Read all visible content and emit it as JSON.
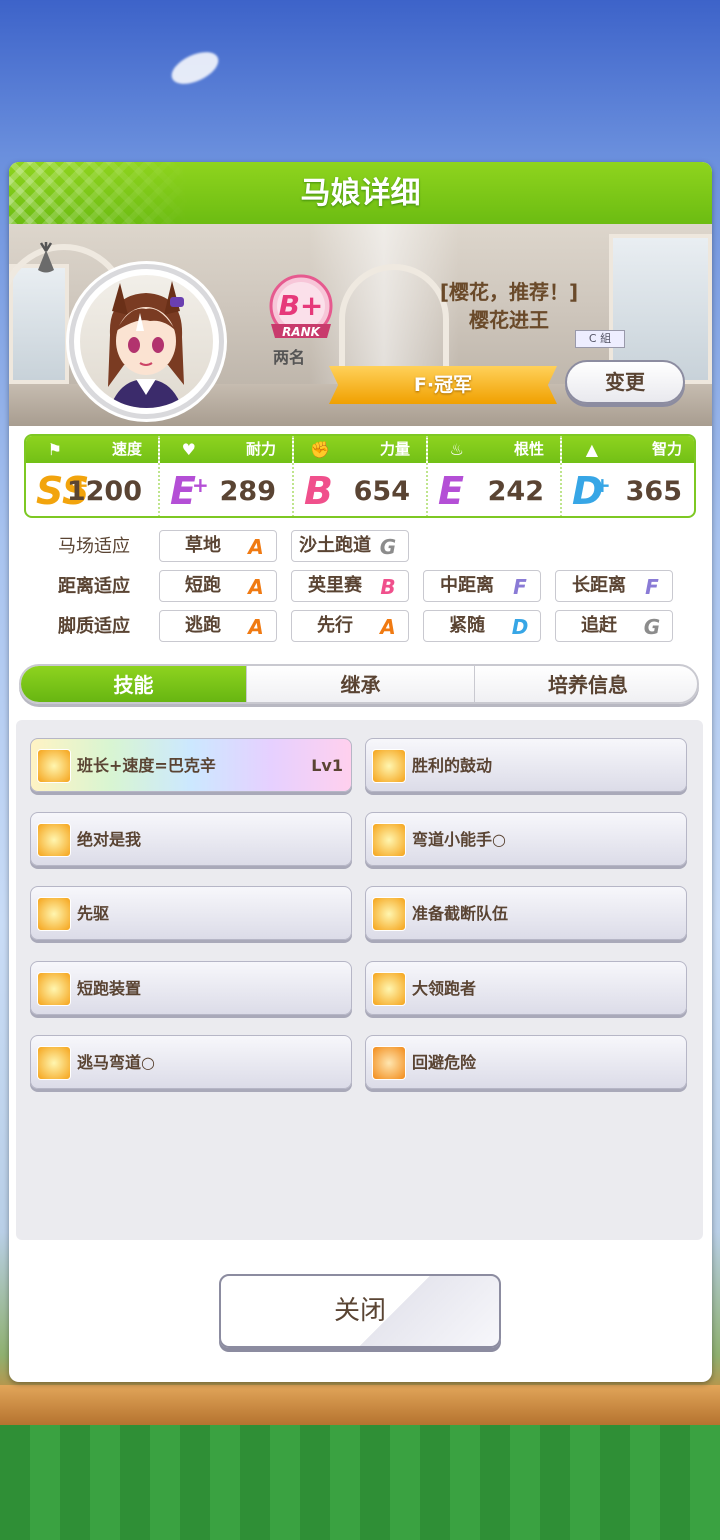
{
  "title": "马娘详细",
  "header": {
    "rank_letter": "B+",
    "rank_word": "RANK",
    "rank_label": "两名",
    "epithet": "[樱花，推荐！]",
    "name": "樱花进王",
    "class_badge": "C 組",
    "title_ribbon": "F·冠军",
    "change_label": "变更"
  },
  "stats": [
    {
      "label": "速度",
      "icon": "shoe-icon",
      "grade": "SS",
      "plus": "+",
      "value": "1200",
      "color": "#f2a40d"
    },
    {
      "label": "耐力",
      "icon": "heart-icon",
      "grade": "E",
      "plus": "+",
      "value": "289",
      "color": "#b44fd6"
    },
    {
      "label": "力量",
      "icon": "muscle-icon",
      "grade": "B",
      "plus": "",
      "value": "654",
      "color": "#f0508c"
    },
    {
      "label": "根性",
      "icon": "flame-icon",
      "grade": "E",
      "plus": "",
      "value": "242",
      "color": "#b44fd6"
    },
    {
      "label": "智力",
      "icon": "graduation-cap-icon",
      "grade": "D",
      "plus": "+",
      "value": "365",
      "color": "#37a6e6"
    }
  ],
  "aptitude": {
    "track": {
      "label": "马场适应",
      "items": [
        {
          "name": "草地",
          "grade": "A"
        },
        {
          "name": "沙土跑道",
          "grade": "G"
        }
      ]
    },
    "distance": {
      "label": "距离适应",
      "items": [
        {
          "name": "短跑",
          "grade": "A"
        },
        {
          "name": "英里赛",
          "grade": "B"
        },
        {
          "name": "中距离",
          "grade": "F"
        },
        {
          "name": "长距离",
          "grade": "F"
        }
      ]
    },
    "style": {
      "label": "脚质适应",
      "items": [
        {
          "name": "逃跑",
          "grade": "A"
        },
        {
          "name": "先行",
          "grade": "A"
        },
        {
          "name": "紧随",
          "grade": "D"
        },
        {
          "name": "追赶",
          "grade": "G"
        }
      ]
    }
  },
  "grade_colors": {
    "A": "#f07a12",
    "B": "#f0508c",
    "D": "#37a6e6",
    "F": "#8a7bd6",
    "G": "#8c8c8c"
  },
  "tabs": [
    "技能",
    "继承",
    "培养信息"
  ],
  "skills": [
    {
      "name": "班长+速度=巴克辛",
      "level": "Lv1",
      "icon": "speed-skill-icon",
      "rainbow": true
    },
    {
      "name": "胜利的鼓动",
      "level": "",
      "icon": "speed-skill-icon"
    },
    {
      "name": "绝对是我",
      "level": "",
      "icon": "speed-skill-icon"
    },
    {
      "name": "弯道小能手○",
      "level": "",
      "icon": "speed-skill-icon"
    },
    {
      "name": "先驱",
      "level": "",
      "icon": "speed-skill-icon"
    },
    {
      "name": "准备截断队伍",
      "level": "",
      "icon": "speed-skill-icon"
    },
    {
      "name": "短跑装置",
      "level": "",
      "icon": "speed-skill-icon"
    },
    {
      "name": "大领跑者",
      "level": "",
      "icon": "speed-skill-icon"
    },
    {
      "name": "逃马弯道○",
      "level": "",
      "icon": "speed-skill-icon"
    },
    {
      "name": "回避危险",
      "level": "",
      "icon": "evade-skill-icon"
    }
  ],
  "close_label": "关闭"
}
